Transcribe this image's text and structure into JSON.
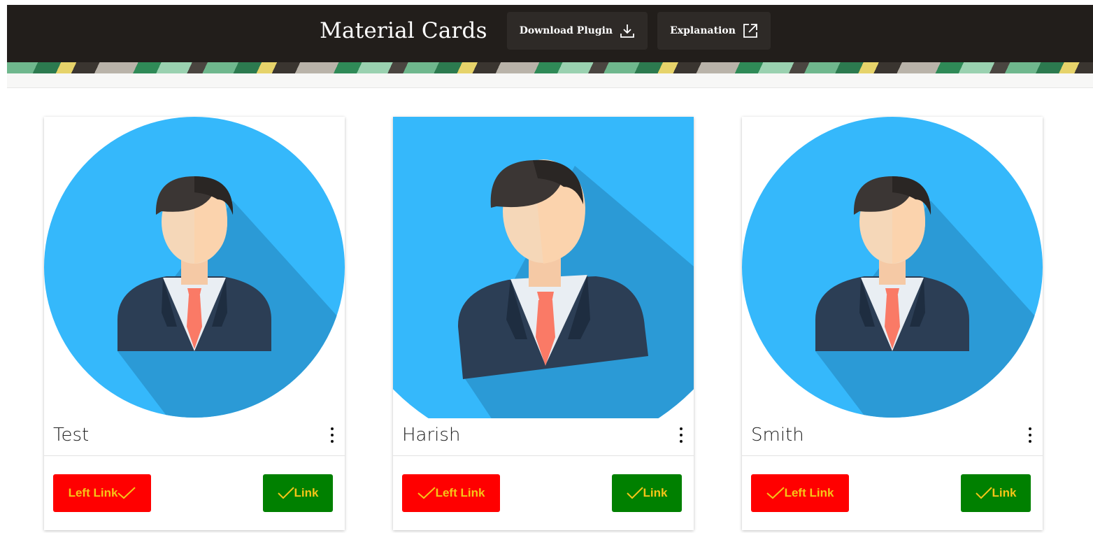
{
  "header": {
    "title": "Material Cards",
    "download_label": "Download Plugin",
    "explanation_label": "Explanation"
  },
  "cards": [
    {
      "name": "Test",
      "left_link": "Left Link",
      "left_check_position": "after",
      "right_link": "Link"
    },
    {
      "name": "Harish",
      "left_link": "Left Link",
      "left_check_position": "before",
      "right_link": "Link"
    },
    {
      "name": "Smith",
      "left_link": "Left Link",
      "left_check_position": "before",
      "right_link": "Link"
    }
  ],
  "icons": {
    "download": "download-icon",
    "external": "external-link-icon",
    "menu": "more-vertical-icon",
    "check": "check-icon",
    "avatar": "businessman-avatar-icon"
  },
  "colors": {
    "header_bg": "#221e1b",
    "avatar_bg": "#35b8fb",
    "left_button": "#ff0000",
    "right_button": "#008000",
    "button_text": "#f5c518"
  }
}
